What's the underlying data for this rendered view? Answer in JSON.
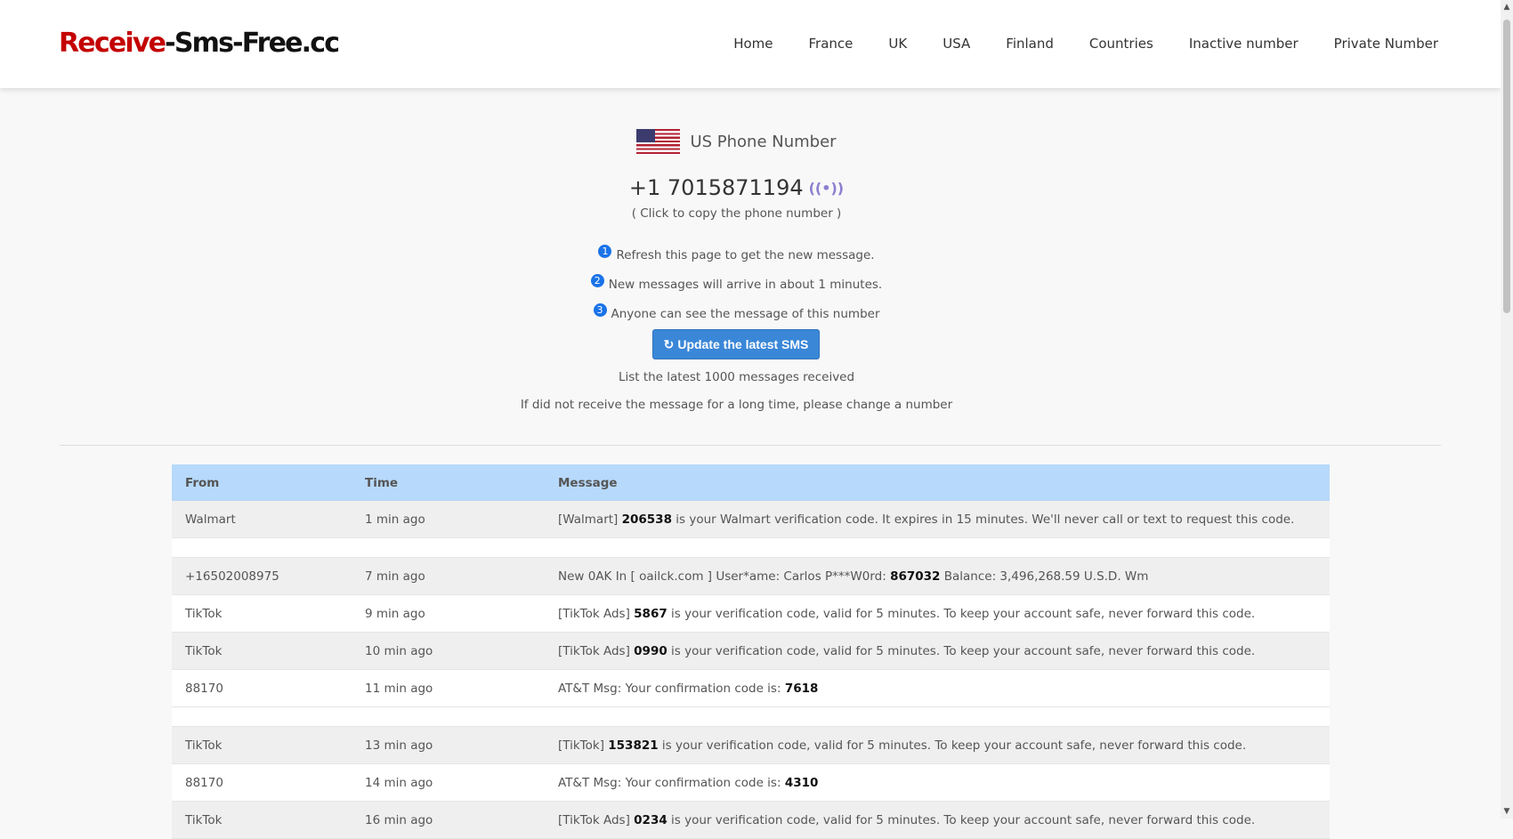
{
  "header": {
    "logo_part1": "Receive",
    "logo_part2": "-Sms-Free.cc",
    "nav": [
      "Home",
      "France",
      "UK",
      "USA",
      "Finland",
      "Countries",
      "Inactive number",
      "Private Number"
    ]
  },
  "number_card": {
    "title": "US Phone Number",
    "phone": "+1 7015871194",
    "signal_icon": "((•))",
    "copy_hint": "( Click to copy the phone number )",
    "steps": [
      {
        "num": "1",
        "text": "Refresh this page to get the new message."
      },
      {
        "num": "2",
        "text": "New messages will arrive in about 1 minutes."
      },
      {
        "num": "3",
        "text": "Anyone can see the message of this number"
      }
    ],
    "update_button": "Update the latest SMS",
    "refresh_icon": "↻",
    "info1": "List the latest 1000 messages received",
    "info2": "If did not receive the message for a long time, please change a number"
  },
  "table": {
    "headers": [
      "From",
      "Time",
      "Message"
    ],
    "rows": [
      {
        "from": "Walmart",
        "time": "1 min ago",
        "pre": "[Walmart] ",
        "code": "206538",
        "post": " is your Walmart verification code. It expires in 15 minutes. We'll never call or text to request this code."
      },
      {
        "from": "+16502008975",
        "time": "7 min ago",
        "pre": "New 0AK In [ oailck.com ] User*ame: Carlos P***W0rd: ",
        "code": "867032",
        "post": " Balance: 3,496,268.59 U.S.D. Wm"
      },
      {
        "from": "TikTok",
        "time": "9 min ago",
        "pre": "[TikTok Ads] ",
        "code": "5867",
        "post": " is your verification code, valid for 5 minutes. To keep your account safe, never forward this code."
      },
      {
        "from": "TikTok",
        "time": "10 min ago",
        "pre": "[TikTok Ads] ",
        "code": "0990",
        "post": " is your verification code, valid for 5 minutes. To keep your account safe, never forward this code."
      },
      {
        "from": "88170",
        "time": "11 min ago",
        "pre": "AT&T Msg: Your confirmation code is: ",
        "code": "7618",
        "post": ""
      },
      {
        "from": "TikTok",
        "time": "13 min ago",
        "pre": "[TikTok] ",
        "code": "153821",
        "post": " is your verification code, valid for 5 minutes. To keep your account safe, never forward this code."
      },
      {
        "from": "88170",
        "time": "14 min ago",
        "pre": "AT&T Msg: Your confirmation code is: ",
        "code": "4310",
        "post": ""
      },
      {
        "from": "TikTok",
        "time": "16 min ago",
        "pre": "[TikTok Ads] ",
        "code": "0234",
        "post": " is your verification code, valid for 5 minutes. To keep your account safe, never forward this code."
      }
    ]
  },
  "colors": {
    "logo_red": "#c40000",
    "button_blue": "#3a87d8",
    "table_header": "#b7d9fb",
    "step_badge": "#1a73e8"
  }
}
